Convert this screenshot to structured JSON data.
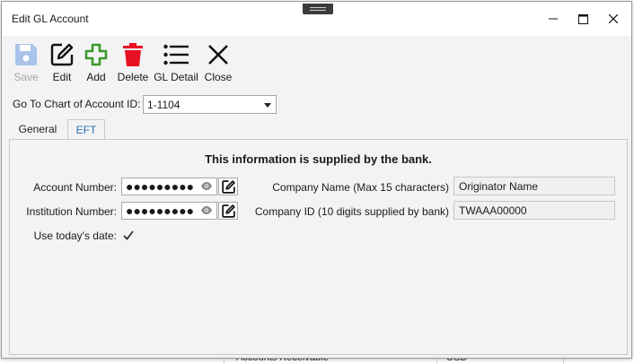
{
  "window": {
    "title": "Edit GL Account"
  },
  "toolbar": {
    "save": "Save",
    "edit": "Edit",
    "add": "Add",
    "delete": "Delete",
    "gl_detail": "GL Detail",
    "close": "Close"
  },
  "goto": {
    "label": "Go To Chart of Account ID:",
    "value": "1-1104"
  },
  "tabs": {
    "general": "General",
    "eft": "EFT",
    "active": "EFT"
  },
  "eft": {
    "banner": "This information is supplied by the bank.",
    "account_number_label": "Account Number:",
    "account_number_value": "●●●●●●●●●",
    "institution_number_label": "Institution Number:",
    "institution_number_value": "●●●●●●●●●",
    "use_today_label": "Use today's date:",
    "use_today_checked": true,
    "company_name_label": "Company Name (Max 15 characters)",
    "company_name_value": "Originator Name",
    "company_id_label": "Company ID (10 digits supplied by bank)",
    "company_id_value": "TWAAA00000"
  },
  "background": {
    "row_text": "Accounts Receivable",
    "row_currency": "USD"
  },
  "colors": {
    "add_green": "#3a9a2a",
    "delete_red": "#e81123",
    "save_disabled": "#a9c3ea",
    "tab_active_text": "#2a6fb0"
  }
}
